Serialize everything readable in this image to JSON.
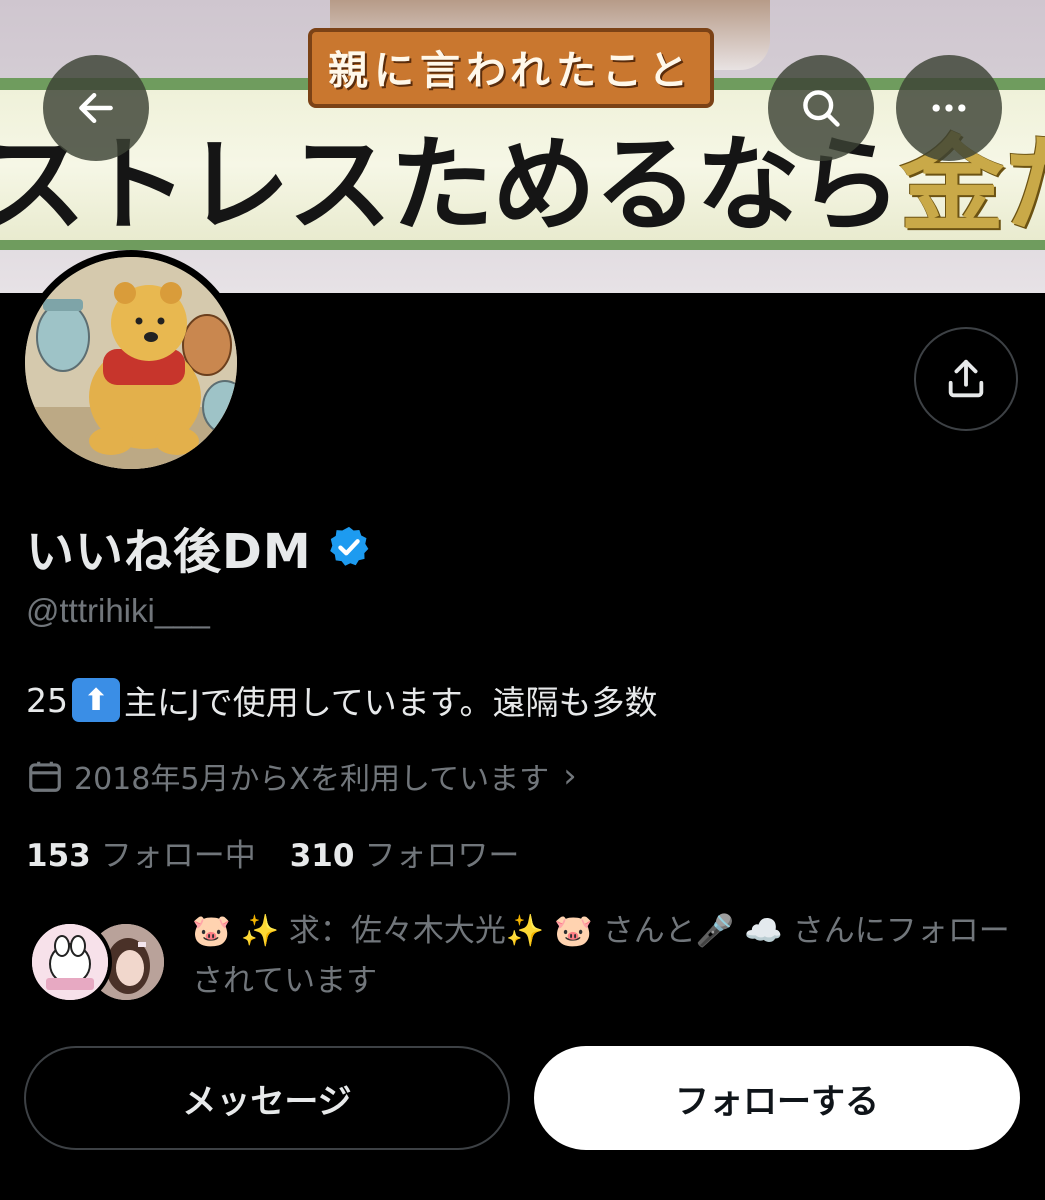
{
  "banner": {
    "caption_small": "親に言われたこと",
    "caption_big_dark": "ストレスためるなら",
    "caption_big_gold": "金ため"
  },
  "profile": {
    "display_name": "いいね後DM",
    "verified": true,
    "handle": "@tttrihiki___",
    "bio_prefix": "25",
    "bio_emoji": "⬆",
    "bio_suffix": "主にJで使用しています。遠隔も多数",
    "joined": "2018年5月からXを利用しています",
    "following_count": "153",
    "following_label": "フォロー中",
    "followers_count": "310",
    "followers_label": "フォロワー",
    "followed_by": "🐷 ✨ 求：佐々木大光✨ 🐷 さんと🎤 ☁️ さんにフォローされています"
  },
  "actions": {
    "message_label": "メッセージ",
    "follow_label": "フォローする"
  },
  "icons": {
    "back": "arrow-left-icon",
    "search": "search-icon",
    "more": "more-horizontal-icon",
    "share": "share-icon",
    "verified": "verified-badge-icon",
    "calendar": "calendar-icon"
  },
  "colors": {
    "background": "#000000",
    "text_primary": "#e7e9ea",
    "text_secondary": "#71767b",
    "verified_blue": "#1d9bf0",
    "follow_button_bg": "#ffffff"
  }
}
